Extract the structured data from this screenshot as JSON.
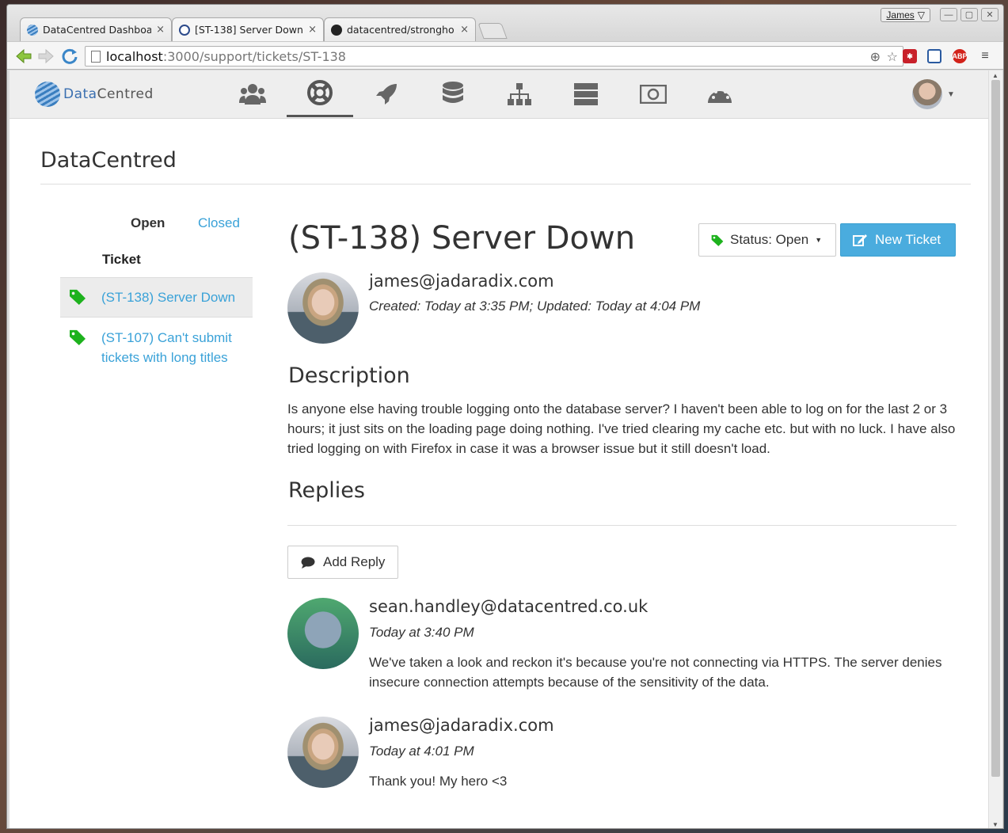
{
  "browser": {
    "tabs": [
      {
        "title": "DataCentred Dashboa",
        "close": "×"
      },
      {
        "title": "[ST-138] Server Down",
        "close": "×"
      },
      {
        "title": "datacentred/strongho",
        "close": "×"
      }
    ],
    "window_user": "James",
    "url_host": "localhost",
    "url_path": ":3000/support/tickets/ST-138",
    "extensions": {
      "abp_label": "ABP"
    }
  },
  "app": {
    "logo": {
      "text_a": "Data",
      "text_b": "Centred"
    },
    "nav_icons": [
      "users-icon",
      "support-icon",
      "rocket-icon",
      "database-icon",
      "network-icon",
      "servers-icon",
      "billing-icon",
      "dashboard-icon"
    ],
    "active_nav": "support-icon"
  },
  "page": {
    "org_title": "DataCentred",
    "filters": {
      "open": "Open",
      "closed": "Closed"
    },
    "list_header": "Ticket",
    "tickets": [
      {
        "label": "(ST-138) Server Down",
        "active": true
      },
      {
        "label": "(ST-107) Can't submit tickets with long titles",
        "active": false
      }
    ],
    "ticket": {
      "title": "(ST-138) Server Down",
      "status_label": "Status: Open",
      "new_ticket_label": "New Ticket",
      "author": "james@jadaradix.com",
      "meta": "Created: Today at 3:35 PM; Updated: Today at 4:04 PM",
      "description_heading": "Description",
      "description": "Is anyone else having trouble logging onto the database server? I haven't been able to log on for the last 2 or 3 hours; it just sits on the loading page doing nothing. I've tried clearing my cache etc. but with no luck. I have also tried logging on with Firefox in case it was a browser issue but it still doesn't load.",
      "replies_heading": "Replies",
      "add_reply_label": "Add Reply"
    },
    "replies": [
      {
        "author": "sean.handley@datacentred.co.uk",
        "time": "Today at 3:40 PM",
        "body": "We've taken a look and reckon it's because you're not connecting via HTTPS. The server denies insecure connection attempts because of the sensitivity of the data."
      },
      {
        "author": "james@jadaradix.com",
        "time": "Today at 4:01 PM",
        "body": "Thank you! My hero <3"
      }
    ]
  },
  "colors": {
    "link": "#3aa2d8",
    "primary_button": "#4aacde",
    "tag": "#1db21d"
  }
}
